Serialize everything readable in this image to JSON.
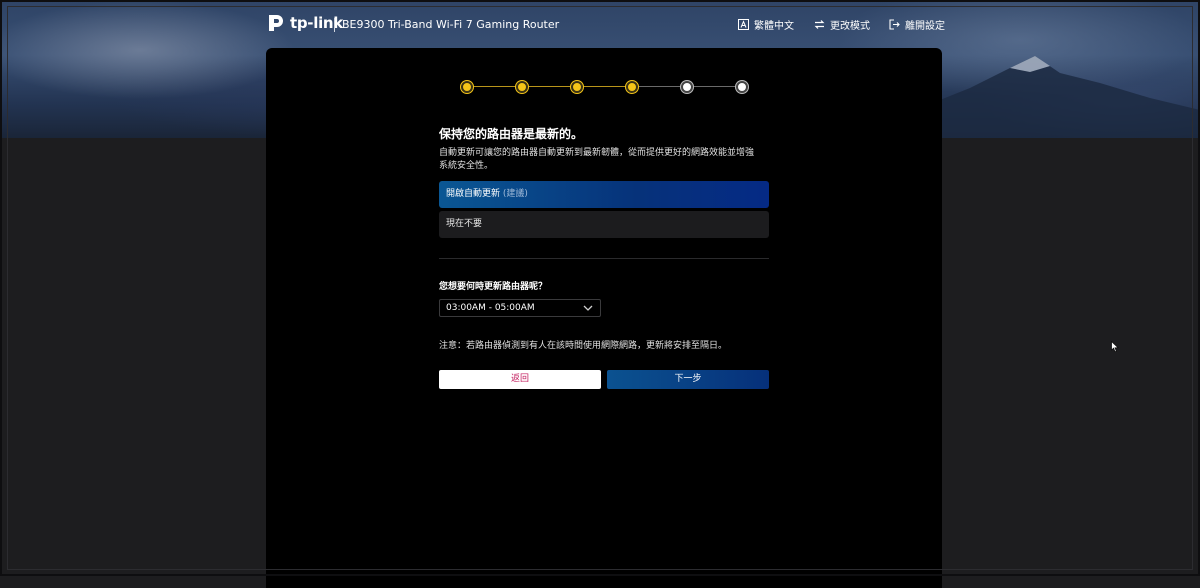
{
  "header": {
    "brand": "tp-link",
    "model": "BE9300 Tri-Band Wi-Fi 7 Gaming Router",
    "actions": [
      {
        "label": "繁體中文",
        "icon": "language-icon"
      },
      {
        "label": "更改模式",
        "icon": "switch-mode-icon"
      },
      {
        "label": "離開設定",
        "icon": "exit-icon"
      }
    ]
  },
  "stepper": {
    "total": 6,
    "completed": 4
  },
  "update": {
    "title": "保持您的路由器是最新的。",
    "description_line1": "自動更新可讓您的路由器自動更新到最新韌體，從而提供更好的網路效能並增強",
    "description_line2": "系統安全性。",
    "option_auto_label": "開啟自動更新",
    "option_auto_hint": "(建議)",
    "option_skip_label": "現在不要",
    "schedule_question": "您想要何時更新路由器呢？",
    "schedule_value": "03:00AM - 05:00AM",
    "note": "注意：若路由器偵測到有人在該時間使用網際網路，更新將安排至隔日。",
    "back_label": "返回",
    "next_label": "下一步"
  },
  "colors": {
    "step_done": "#f5c518",
    "step_todo": "#ffffff",
    "accent": "#06327a",
    "back_text": "#c2185b"
  }
}
